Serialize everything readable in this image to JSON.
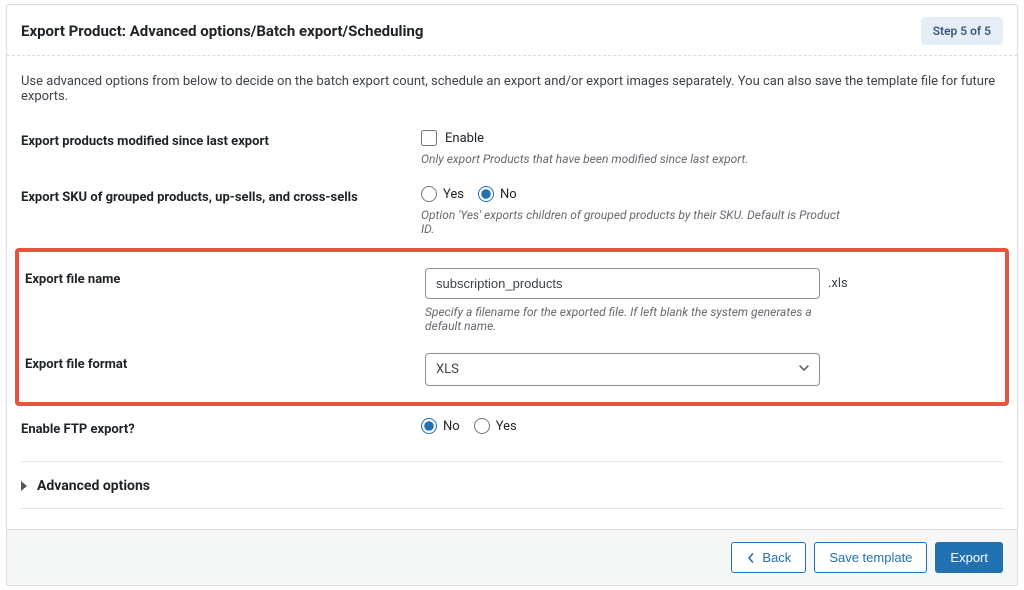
{
  "header": {
    "title": "Export Product: Advanced options/Batch export/Scheduling",
    "step_badge": "Step 5 of 5"
  },
  "intro": "Use advanced options from below to decide on the batch export count, schedule an export and/or export images separately. You can also save the template file for future exports.",
  "fields": {
    "modified_since": {
      "label": "Export products modified since last export",
      "checkbox_label": "Enable",
      "hint": "Only export Products that have been modified since last export."
    },
    "sku_grouped": {
      "label": "Export SKU of grouped products, up-sells, and cross-sells",
      "option_yes": "Yes",
      "option_no": "No",
      "selected": "No",
      "hint": "Option 'Yes' exports children of grouped products by their SKU. Default is Product ID."
    },
    "file_name": {
      "label": "Export file name",
      "value": "subscription_products",
      "extension": ".xls",
      "hint": "Specify a filename for the exported file. If left blank the system generates a default name."
    },
    "file_format": {
      "label": "Export file format",
      "value": "XLS"
    },
    "ftp": {
      "label": "Enable FTP export?",
      "option_no": "No",
      "option_yes": "Yes",
      "selected": "No"
    }
  },
  "accordion": {
    "advanced_options": "Advanced options"
  },
  "footer": {
    "back": "Back",
    "save_template": "Save template",
    "export": "Export"
  }
}
